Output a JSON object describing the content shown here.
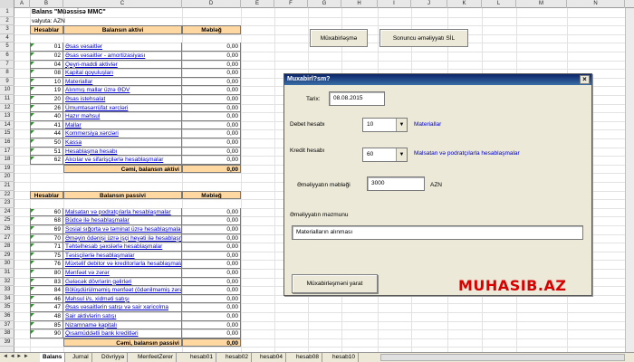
{
  "columns": [
    "A",
    "B",
    "C",
    "D",
    "E",
    "F",
    "G",
    "H",
    "I",
    "J",
    "K",
    "L",
    "M",
    "N"
  ],
  "rows": [
    "1",
    "2",
    "3",
    "4",
    "5",
    "6",
    "7",
    "8",
    "9",
    "10",
    "11",
    "12",
    "13",
    "14",
    "15",
    "16",
    "17",
    "18",
    "19",
    "20",
    "21",
    "22",
    "23",
    "24",
    "25",
    "26",
    "27",
    "28",
    "29",
    "30",
    "31",
    "32",
    "33",
    "34",
    "35",
    "36",
    "37",
    "38",
    "39"
  ],
  "sheet": {
    "title": "Balans \"Müəssisə MMC\"",
    "currency": "valyuta: AZN",
    "assets_header": {
      "code": "Hesablar",
      "name": "Balansın aktivi",
      "amount": "Məbləğ"
    },
    "assets": [
      {
        "code": "01",
        "name": "Əsas vəsaitlər",
        "amount": "0,00"
      },
      {
        "code": "02",
        "name": "Əsas vəsaitlər - amortizasiyası",
        "amount": "0,00"
      },
      {
        "code": "04",
        "name": "Qeyri-maddi aktivlər",
        "amount": "0,00"
      },
      {
        "code": "08",
        "name": "Kapital qoyuluşları",
        "amount": "0,00"
      },
      {
        "code": "10",
        "name": "Materiallar",
        "amount": "0,00"
      },
      {
        "code": "19",
        "name": "Alınmış mallar üzrə ƏDV",
        "amount": "0,00"
      },
      {
        "code": "20",
        "name": "Əsas istehsalat",
        "amount": "0,00"
      },
      {
        "code": "26",
        "name": "Ümumtəsərrüfat xərcləri",
        "amount": "0,00"
      },
      {
        "code": "40",
        "name": "Hazır məhsul",
        "amount": "0,00"
      },
      {
        "code": "41",
        "name": "Mallar",
        "amount": "0,00"
      },
      {
        "code": "44",
        "name": "Kommersiya xərcləri",
        "amount": "0,00"
      },
      {
        "code": "50",
        "name": "Kassa",
        "amount": "0,00"
      },
      {
        "code": "51",
        "name": "Hesablaşma hesabı",
        "amount": "0,00"
      },
      {
        "code": "62",
        "name": "Alıcılar və sifarişçilərlə hesablaşmalar",
        "amount": "0,00"
      }
    ],
    "assets_total": {
      "label": "Cəmi, balansın aktivi",
      "amount": "0,00"
    },
    "liab_header": {
      "code": "Hesablar",
      "name": "Balansın passivi",
      "amount": "Məbləğ"
    },
    "liabilities": [
      {
        "code": "60",
        "name": "Malsatan və podratçılarla hesablaşmalar",
        "amount": "0,00"
      },
      {
        "code": "68",
        "name": "Büdcə ilə hesablaşmalar",
        "amount": "0,00"
      },
      {
        "code": "69",
        "name": "Sosial sığorta və təminat üzrə hesablaşmalar",
        "amount": "0,00"
      },
      {
        "code": "70",
        "name": "Əməyin ödənişi üzrə işçi heyəti ilə hesablaşmalar",
        "amount": "0,00"
      },
      {
        "code": "71",
        "name": "Təhtəlhesab şəxslərlə hesablaşmalar",
        "amount": "0,00"
      },
      {
        "code": "75",
        "name": "Təsisçilərlə hesablaşmalar",
        "amount": "0,00"
      },
      {
        "code": "76",
        "name": "Müxtəlif debitor və kreditorlarla hesablaşmalar",
        "amount": "0,00"
      },
      {
        "code": "80",
        "name": "Mənfəət və zərər",
        "amount": "0,00"
      },
      {
        "code": "83",
        "name": "Gələcək dövrlərin gəlirləri",
        "amount": "0,00"
      },
      {
        "code": "84",
        "name": "Bölüşdürülməmiş mənfəət (ödənilməmiş zərər)",
        "amount": "0,00"
      },
      {
        "code": "46",
        "name": "Məhsul i/s, xidməti satışı",
        "amount": "0,00"
      },
      {
        "code": "47",
        "name": "Əsas vəsaitlərin satışı və sair xaricolma",
        "amount": "0,00"
      },
      {
        "code": "48",
        "name": "Sair aktivlərin satışı",
        "amount": "0,00"
      },
      {
        "code": "85",
        "name": "Nizamnamə kapitalı",
        "amount": "0,00"
      },
      {
        "code": "90",
        "name": "Qısamüddətli bank kreditləri",
        "amount": "0,00"
      }
    ],
    "liab_total": {
      "label": "Cəmi, balansın passivi",
      "amount": "0,00"
    }
  },
  "sheet_buttons": {
    "muxabirlesme": "Müxabirləşmə",
    "sil": "Sonuncu əməliyyatı SİL"
  },
  "dialog": {
    "title": "Muxabirl?sm?",
    "close": "×",
    "date_label": "Tarix:",
    "date_value": "08.08.2015",
    "debit_label": "Debet hesabı",
    "debit_value": "10",
    "debit_name": "Materiallar",
    "credit_label": "Kredit hesabı",
    "credit_value": "60",
    "credit_name": "Malsatan və podratçılarla hesablaşmalar",
    "amount_label": "Əməliyyatın məbləği",
    "amount_value": "3000",
    "amount_unit": "AZN",
    "content_label": "Əməliyyatın məzmunu",
    "content_value": "Materialların alınması",
    "create_button": "Müxabirləşməni yarat",
    "brand": "MUHASIB.AZ"
  },
  "tabs": [
    "Balans",
    "Jurnal",
    "Dövriyyə",
    "MenfeetZerer",
    "hesab01",
    "hesab02",
    "hesab04",
    "hesab08",
    "hesab10"
  ],
  "tab_nav": "◄ ◄ ► ►",
  "colors": {
    "header_fill": "#ffd7a0",
    "link": "#0000cc",
    "brand": "#d80000",
    "dialog_title": "#0a246a"
  }
}
